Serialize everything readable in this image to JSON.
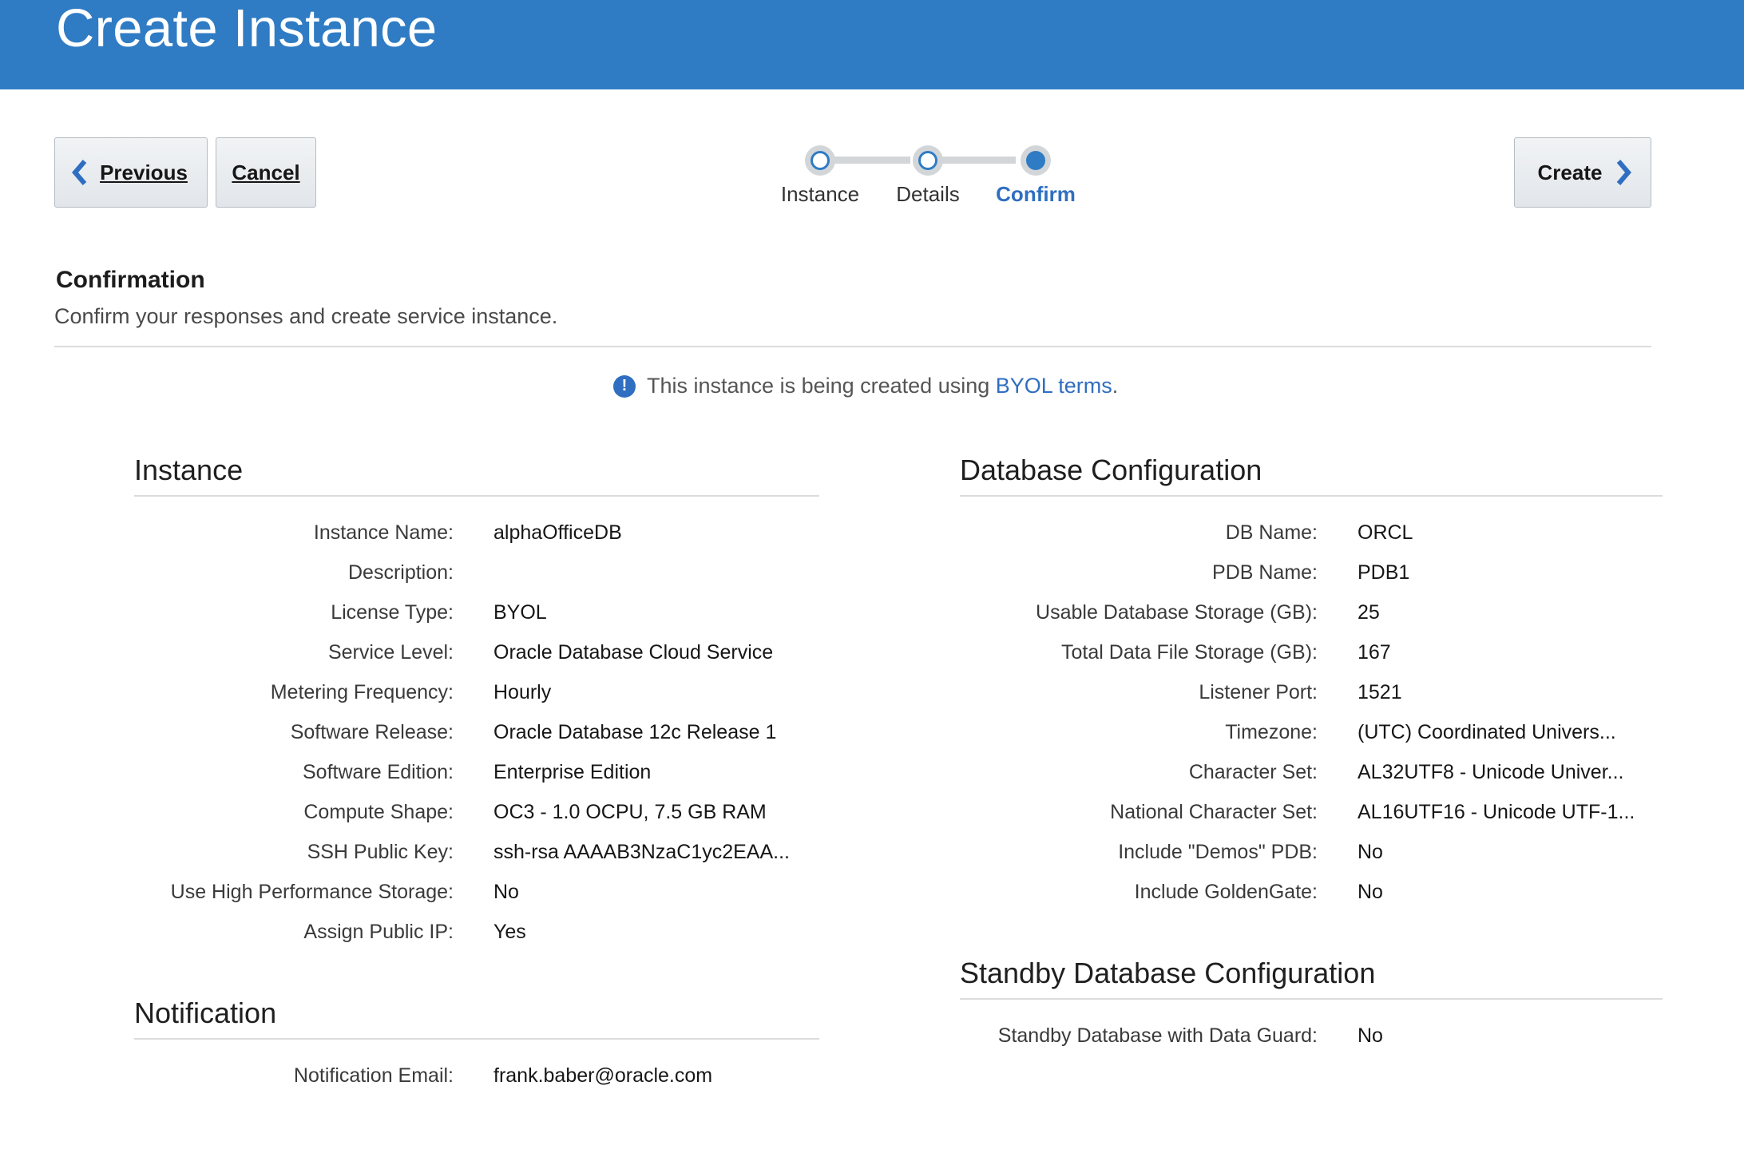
{
  "header": {
    "title": "Create Instance"
  },
  "toolbar": {
    "previous_label": "Previous",
    "cancel_label": "Cancel",
    "create_label": "Create"
  },
  "stepper": {
    "steps": [
      {
        "label": "Instance",
        "state": "done"
      },
      {
        "label": "Details",
        "state": "done"
      },
      {
        "label": "Confirm",
        "state": "active"
      }
    ]
  },
  "confirmation": {
    "title": "Confirmation",
    "subtitle": "Confirm your responses and create service instance.",
    "info_prefix": "This instance is being created using ",
    "info_link": "BYOL terms",
    "info_suffix": "."
  },
  "instance": {
    "heading": "Instance",
    "rows": [
      {
        "label": "Instance Name:",
        "value": "alphaOfficeDB"
      },
      {
        "label": "Description:",
        "value": ""
      },
      {
        "label": "License Type:",
        "value": "BYOL"
      },
      {
        "label": "Service Level:",
        "value": "Oracle Database Cloud Service"
      },
      {
        "label": "Metering Frequency:",
        "value": "Hourly"
      },
      {
        "label": "Software Release:",
        "value": "Oracle Database 12c Release 1"
      },
      {
        "label": "Software Edition:",
        "value": "Enterprise Edition"
      },
      {
        "label": "Compute Shape:",
        "value": "OC3 - 1.0 OCPU, 7.5 GB RAM"
      },
      {
        "label": "SSH Public Key:",
        "value": "ssh-rsa AAAAB3NzaC1yc2EAA..."
      },
      {
        "label": "Use High Performance Storage:",
        "value": "No"
      },
      {
        "label": "Assign Public IP:",
        "value": "Yes"
      }
    ]
  },
  "notification": {
    "heading": "Notification",
    "rows": [
      {
        "label": "Notification Email:",
        "value": "frank.baber@oracle.com"
      }
    ]
  },
  "database": {
    "heading": "Database Configuration",
    "rows": [
      {
        "label": "DB Name:",
        "value": "ORCL"
      },
      {
        "label": "PDB Name:",
        "value": "PDB1"
      },
      {
        "label": "Usable Database Storage (GB):",
        "value": "25"
      },
      {
        "label": "Total Data File Storage (GB):",
        "value": "167"
      },
      {
        "label": "Listener Port:",
        "value": "1521"
      },
      {
        "label": "Timezone:",
        "value": "(UTC) Coordinated Univers..."
      },
      {
        "label": "Character Set:",
        "value": "AL32UTF8 - Unicode Univer..."
      },
      {
        "label": "National Character Set:",
        "value": "AL16UTF16 - Unicode UTF-1..."
      },
      {
        "label": "Include \"Demos\" PDB:",
        "value": "No"
      },
      {
        "label": "Include GoldenGate:",
        "value": "No"
      }
    ]
  },
  "standby": {
    "heading": "Standby Database Configuration",
    "rows": [
      {
        "label": "Standby Database with Data Guard:",
        "value": "No"
      }
    ]
  },
  "colors": {
    "header_bg": "#2f7cc4",
    "accent": "#2f6ec0",
    "button_bg": "#e8ebee"
  },
  "icons": {
    "previous": "chevron-left-icon",
    "create": "chevron-right-icon",
    "info": "info-icon"
  }
}
